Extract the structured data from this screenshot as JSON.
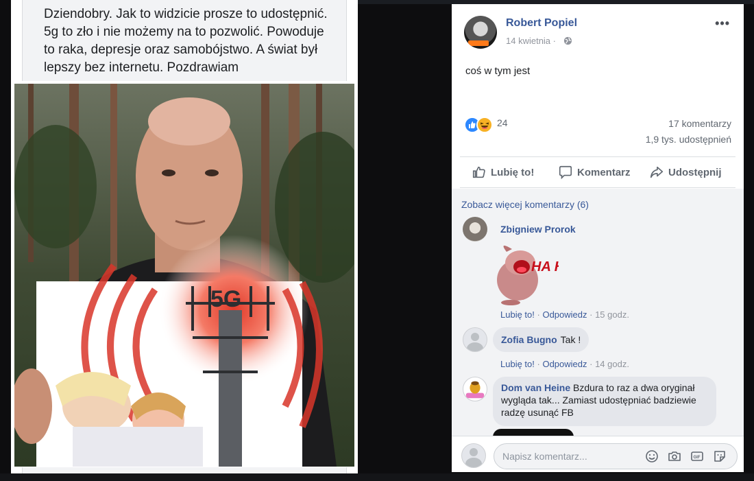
{
  "shared_image": {
    "caption": "Dziendobry. Jak to widzicie prosze to udostępnić. 5g to zło i nie możemy na to pozwolić. Powoduje to raka, depresje oraz samobójstwo. A świat był lepszy bez internetu. Pozdrawiam",
    "sign_text": "5G"
  },
  "post": {
    "author": "Robert Popiel",
    "date": "14 kwietnia ·",
    "privacy_icon": "globe-icon",
    "more_icon": "ellipsis-icon",
    "text": "coś w tym jest",
    "reactions": {
      "types": [
        "like",
        "haha"
      ],
      "count": "24"
    },
    "comments_count": "17 komentarzy",
    "shares_count": "1,9 tys. udostępnień"
  },
  "actions": {
    "like": "Lubię to!",
    "comment": "Komentarz",
    "share": "Udostępnij"
  },
  "comments_section": {
    "see_more": "Zobacz więcej komentarzy (6)",
    "comments": [
      {
        "author": "Zbigniew Prorok",
        "sticker": "HA HA",
        "like": "Lubię to!",
        "reply": "Odpowiedz",
        "time": "· 15 godz."
      },
      {
        "author": "Zofia Bugno",
        "text": "Tak !",
        "like": "Lubię to!",
        "reply": "Odpowiedz",
        "time": "· 14 godz."
      },
      {
        "author": "Dom van Heine",
        "text": "Bzdura to raz a dwa oryginał wygląda tak... Zamiast udostępniać badziewie radzę usunąć FB"
      }
    ]
  },
  "composer": {
    "placeholder": "Napisz komentarz...",
    "icons": [
      "emoji-icon",
      "camera-icon",
      "gif-icon",
      "sticker-icon"
    ]
  },
  "colors": {
    "link_blue": "#385898",
    "meta_gray": "#90949c",
    "like_blue": "#2d88ff",
    "haha_yellow": "#f7b125"
  }
}
